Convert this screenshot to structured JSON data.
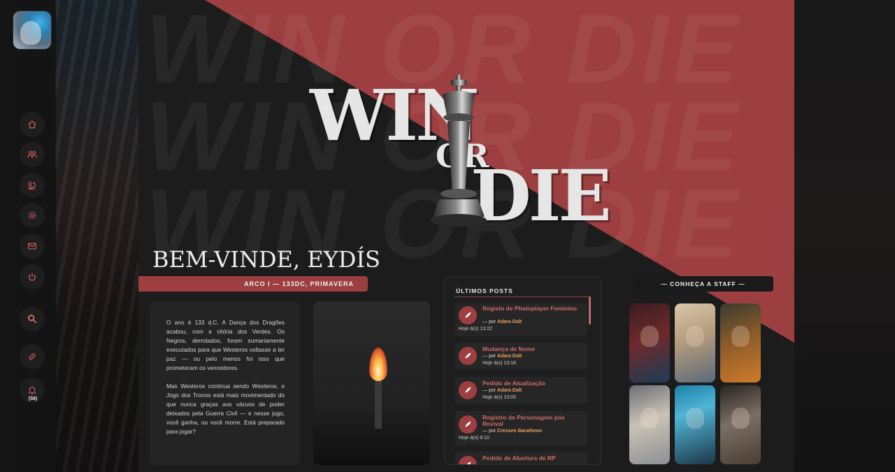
{
  "sidebar": {
    "nav": [
      {
        "name": "home-icon"
      },
      {
        "name": "users-icon"
      },
      {
        "name": "books-icon"
      },
      {
        "name": "gear-icon"
      },
      {
        "name": "mail-icon"
      },
      {
        "name": "power-icon"
      },
      {
        "name": "search-icon"
      },
      {
        "name": "link-icon"
      },
      {
        "name": "bell-icon"
      }
    ],
    "notifications": "(58)"
  },
  "banner": {
    "watermark": "WIN OR DIE",
    "logo_win": "WIN",
    "logo_or": "OR",
    "logo_die": "DIE"
  },
  "welcome": "BEM-VINDE, EYDÍS",
  "arc": "ARCO I — 133DC, PRIMAVERA",
  "intro": {
    "p1": "O ano é 133 d.C. A Dança dos Dragões acabou, com a vitória dos Verdes. Os Negros, derrotados, foram sumariamente executados para que Westeros voltasse a ter paz — ou pelo menos foi isso que prometeram os vencedores.",
    "p2": "Mas Westeros continua sendo Westeros, o Jogo dos Tronos está mais movimentado do que nunca graças aos vácuos de poder deixados pela Guerra Civil — e nesse jogo, você ganha, ou você morre. Está preparado para jogar?"
  },
  "posts": {
    "title": "ÚLTIMOS POSTS",
    "items": [
      {
        "title": "Registo de Photoplayer Feminino",
        "by": "— por ",
        "author": "Adara Dalt",
        "date": "Hoje à(s) 13:22"
      },
      {
        "title": "Mudança de Nome",
        "by": "— por ",
        "author": "Adara Dalt",
        "date": "Hoje à(s) 13:18"
      },
      {
        "title": "Pedido de Atualização",
        "by": "— por ",
        "author": "Adara Dalt",
        "date": "Hoje à(s) 13:05"
      },
      {
        "title": "Registro de Personagem pós Revival",
        "by": "— por ",
        "author": "Cressen Baratheon",
        "date": "Hoje à(s) 6:10"
      },
      {
        "title": "Pedido de Abertura de RP"
      }
    ]
  },
  "staff": {
    "title": "— CONHEÇA A STAFF —"
  },
  "colors": {
    "accent": "#9d3f40",
    "post_title": "#d06a6a",
    "author": "#e6a25a"
  }
}
